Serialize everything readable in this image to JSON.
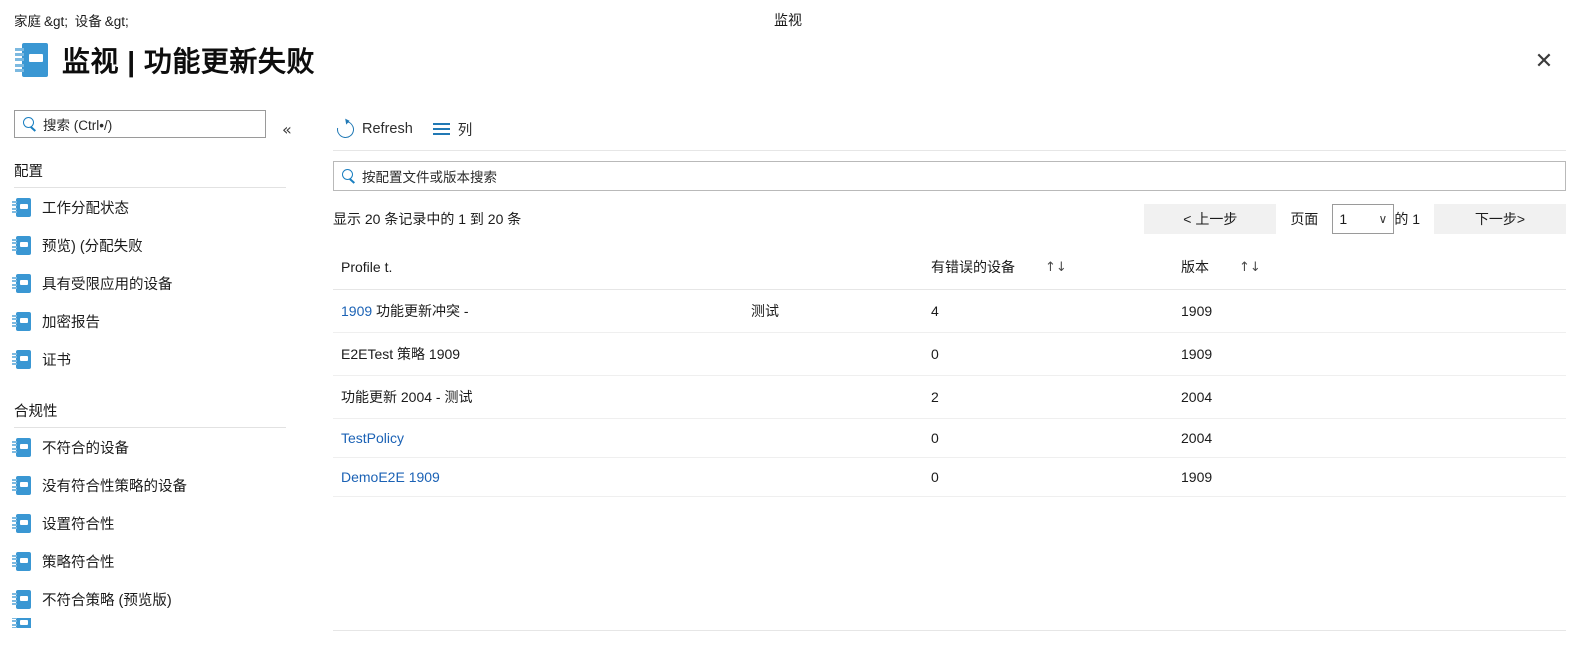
{
  "breadcrumb": {
    "items": [
      "家庭",
      "设备"
    ],
    "separator": "&gt;"
  },
  "header": {
    "center_label": "监视",
    "title": "监视 | 功能更新失败",
    "close_label": "✕",
    "icon": "notebook-icon"
  },
  "sidebar": {
    "search": {
      "placeholder": "搜索 (Ctrl•/)",
      "value": "",
      "icon": "search-icon"
    },
    "collapse_label": "«",
    "sections": [
      {
        "heading": "配置",
        "items": [
          {
            "label": "工作分配状态",
            "icon": "notebook-icon"
          },
          {
            "label": "预览) (分配失败",
            "icon": "notebook-icon"
          },
          {
            "label": "具有受限应用的设备",
            "icon": "notebook-icon"
          },
          {
            "label": "加密报告",
            "icon": "notebook-icon"
          },
          {
            "label": "证书",
            "icon": "notebook-icon"
          }
        ]
      },
      {
        "heading": "合规性",
        "items": [
          {
            "label": "不符合的设备",
            "icon": "notebook-icon"
          },
          {
            "label": "没有符合性策略的设备",
            "icon": "notebook-icon"
          },
          {
            "label": "设置符合性",
            "icon": "notebook-icon"
          },
          {
            "label": "策略符合性",
            "icon": "notebook-icon"
          },
          {
            "label": "不符合策略 (预览版)",
            "icon": "notebook-icon"
          }
        ]
      }
    ]
  },
  "toolbar": {
    "refresh_label": "Refresh",
    "refresh_icon": "refresh-icon",
    "columns_label": "列",
    "columns_icon": "columns-icon"
  },
  "filter": {
    "placeholder": "按配置文件或版本搜索",
    "value": "",
    "icon": "search-icon"
  },
  "pager": {
    "info": "显示 20 条记录中的 1 到 20 条",
    "prev_label": "< 上一步",
    "page_label": "页面",
    "page_value": "1",
    "caret": "∨",
    "of_label": "的 1",
    "next_label": "下一步>"
  },
  "table": {
    "columns": [
      {
        "label": "Profile t.",
        "sortable": false
      },
      {
        "label": "",
        "sortable": false
      },
      {
        "label": "有错误的设备",
        "sortable": true,
        "sort_icon": "sort-arrows-icon"
      },
      {
        "label": "版本",
        "sortable": true,
        "sort_icon": "sort-arrows-icon"
      }
    ],
    "rows": [
      {
        "name_link": "1909",
        "name_rest": " 功能更新冲突 -",
        "sub": "测试",
        "errors": "4",
        "errors_dim": false,
        "version": "1909",
        "is_link": false
      },
      {
        "name_link": "",
        "name_rest": "E2ETest 策略 1909",
        "sub": "",
        "errors": "0",
        "errors_dim": true,
        "version": "1909",
        "is_link": false
      },
      {
        "name_link": "",
        "name_rest": "功能更新 2004 - 测试",
        "sub": "",
        "errors": "2",
        "errors_dim": true,
        "version": "2004",
        "is_link": false
      },
      {
        "name_link": "",
        "name_rest": "TestPolicy",
        "sub": "",
        "errors": "0",
        "errors_dim": true,
        "version": "2004",
        "is_link": true
      },
      {
        "name_link": "",
        "name_rest": "DemoE2E 1909",
        "sub": "",
        "errors": "0",
        "errors_dim": true,
        "version": "1909",
        "is_link": true
      }
    ]
  },
  "colors": {
    "accent": "#3a97d3",
    "link": "#1b62b5",
    "icon_blue": "#2179b5",
    "button_bg": "#f1f1f1"
  }
}
